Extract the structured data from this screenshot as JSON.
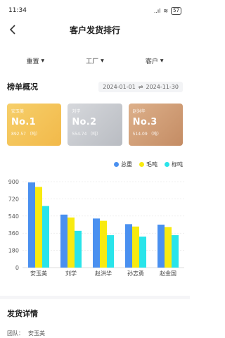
{
  "status": {
    "time": "11:34",
    "battery": "57",
    "signal": "..ıl",
    "wifi": "≋"
  },
  "nav": {
    "title": "客户发货排行"
  },
  "filters": [
    {
      "label": "重置"
    },
    {
      "label": "工厂"
    },
    {
      "label": "客户"
    }
  ],
  "overview": {
    "title": "榜单概况",
    "date_start": "2024-01-01",
    "date_sep": "⇌",
    "date_end": "2024-11-30"
  },
  "cards": [
    {
      "name": "安玉美",
      "rank": "No.1",
      "amount": "892.57 （吨）"
    },
    {
      "name": "刘学",
      "rank": "No.2",
      "amount": "554.74 （吨）"
    },
    {
      "name": "赵洪华",
      "rank": "No.3",
      "amount": "514.09 （吨）"
    }
  ],
  "chart_data": {
    "type": "bar",
    "categories": [
      "安玉美",
      "刘学",
      "赵洪华",
      "孙志勇",
      "赵金国"
    ],
    "series": [
      {
        "name": "总重",
        "color": "#4a90f0",
        "values": [
          892,
          555,
          514,
          455,
          450
        ]
      },
      {
        "name": "毛吨",
        "color": "#f8ea10",
        "values": [
          845,
          525,
          490,
          430,
          425
        ]
      },
      {
        "name": "标吨",
        "color": "#29e4ea",
        "values": [
          645,
          385,
          340,
          325,
          340
        ]
      }
    ],
    "ylim": [
      0,
      900
    ],
    "yticks": [
      0,
      180,
      360,
      540,
      720,
      900
    ],
    "grid": true,
    "legend": "top-right"
  },
  "details": {
    "title": "发货详情",
    "row_label": "团队：",
    "row_value": "安玉美"
  }
}
